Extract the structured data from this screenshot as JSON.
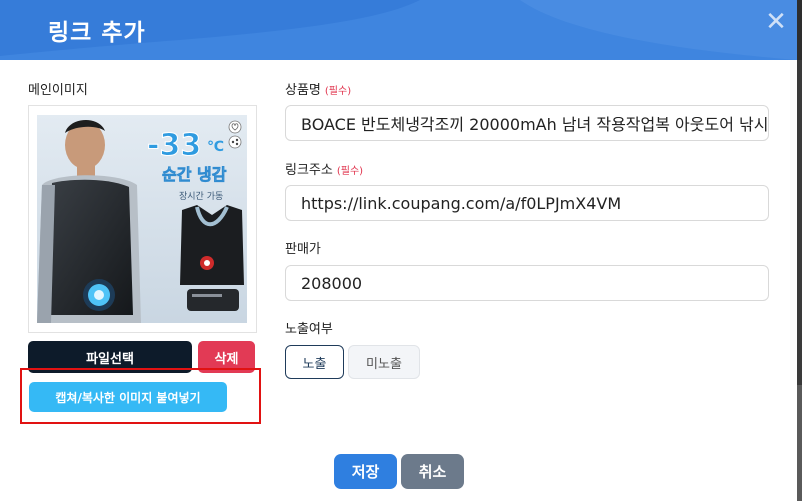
{
  "dialog": {
    "title": "링크 추가",
    "close_icon": "close-icon",
    "accent_color": "#3f85df"
  },
  "image_section": {
    "label": "메인이미지",
    "product_image": {
      "temperature_text": "-33",
      "unit_text": "℃",
      "headline": "순간 냉감",
      "subline": "장시간 가동"
    },
    "file_button": "파일선택",
    "delete_button": "삭제",
    "paste_button": "캡쳐/복사한 이미지 붙여넣기"
  },
  "form": {
    "product_name": {
      "label": "상품명",
      "required": "(필수)",
      "value": "BOACE 반도체냉각조끼 20000mAh 남녀 작용작업복 아웃도어 낚시"
    },
    "link_url": {
      "label": "링크주소",
      "required": "(필수)",
      "value": "https://link.coupang.com/a/f0LPJmX4VM"
    },
    "price": {
      "label": "판매가",
      "value": "208000"
    },
    "visibility": {
      "label": "노출여부",
      "options": [
        "노출",
        "미노출"
      ],
      "selected": "노출"
    }
  },
  "footer": {
    "save_button": "저장",
    "cancel_button": "취소"
  }
}
